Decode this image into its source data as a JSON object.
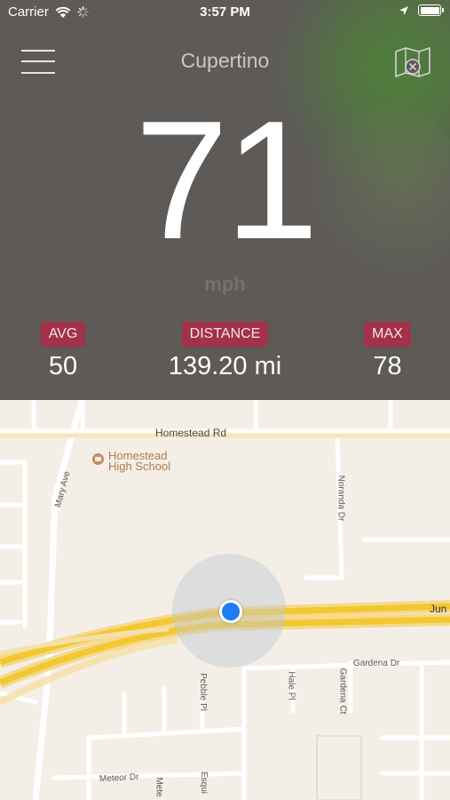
{
  "status_bar": {
    "carrier": "Carrier",
    "time": "3:57 PM"
  },
  "header": {
    "city": "Cupertino"
  },
  "speed": {
    "value": "71",
    "unit": "mph"
  },
  "stats": {
    "avg": {
      "label": "AVG",
      "value": "50"
    },
    "distance": {
      "label": "DISTANCE",
      "value": "139.20 mi"
    },
    "max": {
      "label": "MAX",
      "value": "78"
    }
  },
  "map": {
    "poi": {
      "line1": "Homestead",
      "line2": "High School"
    },
    "roads": {
      "homestead": "Homestead Rd",
      "mary": "Mary Ave",
      "noranda": "Noranda Dr",
      "jun": "Jun",
      "gardena_dr": "Gardena Dr",
      "hale": "Hale Pl",
      "gardena_ct": "Gardena Ct",
      "pebble": "Pebble Pl",
      "meteor": "Meteor Dr",
      "mete": "Mete",
      "esqui": "Esqui"
    }
  },
  "colors": {
    "badge": "#a33149",
    "panel": "#5d5a58",
    "location": "#1f7cf2"
  }
}
